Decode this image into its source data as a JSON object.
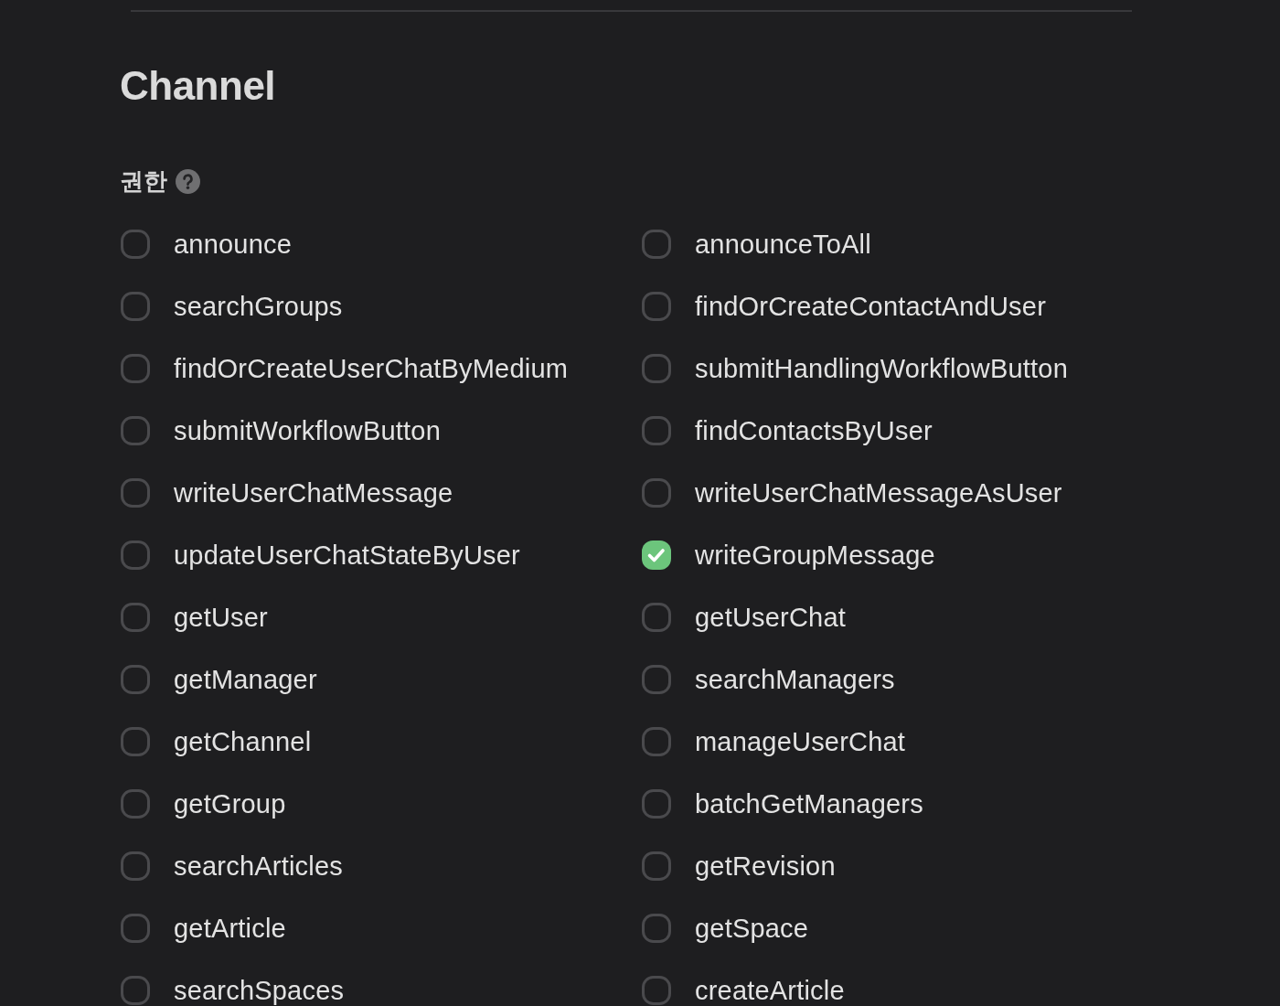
{
  "section": {
    "title": "Channel",
    "permissions_label": "권한"
  },
  "permissions": [
    {
      "label": "announce",
      "checked": false
    },
    {
      "label": "announceToAll",
      "checked": false
    },
    {
      "label": "searchGroups",
      "checked": false
    },
    {
      "label": "findOrCreateContactAndUser",
      "checked": false
    },
    {
      "label": "findOrCreateUserChatByMedium",
      "checked": false
    },
    {
      "label": "submitHandlingWorkflowButton",
      "checked": false
    },
    {
      "label": "submitWorkflowButton",
      "checked": false
    },
    {
      "label": "findContactsByUser",
      "checked": false
    },
    {
      "label": "writeUserChatMessage",
      "checked": false
    },
    {
      "label": "writeUserChatMessageAsUser",
      "checked": false
    },
    {
      "label": "updateUserChatStateByUser",
      "checked": false
    },
    {
      "label": "writeGroupMessage",
      "checked": true
    },
    {
      "label": "getUser",
      "checked": false
    },
    {
      "label": "getUserChat",
      "checked": false
    },
    {
      "label": "getManager",
      "checked": false
    },
    {
      "label": "searchManagers",
      "checked": false
    },
    {
      "label": "getChannel",
      "checked": false
    },
    {
      "label": "manageUserChat",
      "checked": false
    },
    {
      "label": "getGroup",
      "checked": false
    },
    {
      "label": "batchGetManagers",
      "checked": false
    },
    {
      "label": "searchArticles",
      "checked": false
    },
    {
      "label": "getRevision",
      "checked": false
    },
    {
      "label": "getArticle",
      "checked": false
    },
    {
      "label": "getSpace",
      "checked": false
    },
    {
      "label": "searchSpaces",
      "checked": false
    },
    {
      "label": "createArticle",
      "checked": false
    }
  ]
}
